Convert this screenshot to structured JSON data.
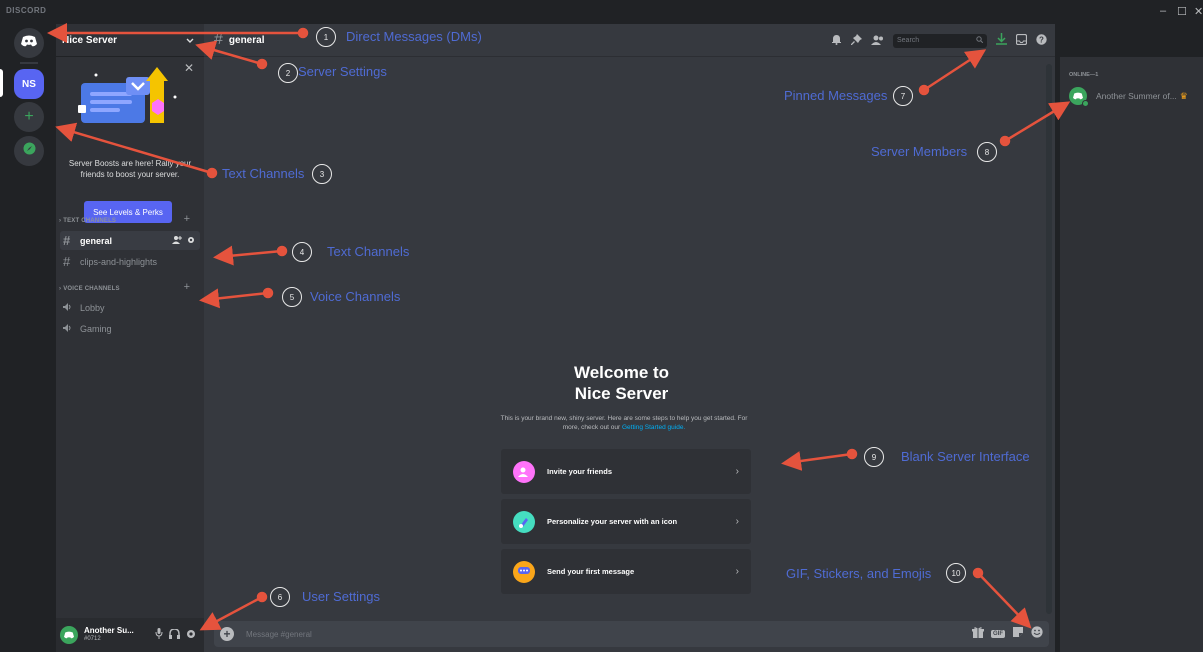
{
  "titlebar": {
    "brand": "DISCORD",
    "minimize": "–",
    "maximize": "☐",
    "close": "✕"
  },
  "rail": {
    "server_initials": "NS",
    "add_symbol": "+"
  },
  "sidebar": {
    "server_name": "Nice Server",
    "boost": {
      "text": "Server Boosts are here! Rally your friends to boost your server.",
      "button": "See Levels & Perks"
    },
    "categories": [
      {
        "label": "TEXT CHANNELS",
        "channels": [
          "general",
          "clips-and-highlights"
        ]
      },
      {
        "label": "VOICE CHANNELS",
        "channels": [
          "Lobby",
          "Gaming"
        ]
      }
    ]
  },
  "user": {
    "name": "Another Su...",
    "tag": "#0712"
  },
  "header": {
    "channel": "general",
    "search_placeholder": "Search"
  },
  "welcome": {
    "title_line1": "Welcome to",
    "title_line2": "Nice Server",
    "desc": "This is your brand new, shiny server. Here are some steps to help you get started. For more, check out our ",
    "link": "Getting Started guide.",
    "actions": [
      "Invite your friends",
      "Personalize your server with an icon",
      "Send your first message"
    ]
  },
  "composer": {
    "placeholder": "Message #general",
    "gif": "GIF"
  },
  "members": {
    "category": "ONLINE—1",
    "list": [
      "Another Summer of..."
    ]
  },
  "annotations": [
    {
      "num": "1",
      "label": "Direct Messages (DMs)"
    },
    {
      "num": "2",
      "label": "Server Settings"
    },
    {
      "num": "3",
      "label": "Text Channels"
    },
    {
      "num": "4",
      "label": "Text Channels"
    },
    {
      "num": "5",
      "label": "Voice Channels"
    },
    {
      "num": "6",
      "label": "User Settings"
    },
    {
      "num": "7",
      "label": "Pinned Messages"
    },
    {
      "num": "8",
      "label": "Server Members"
    },
    {
      "num": "9",
      "label": "Blank Server Interface"
    },
    {
      "num": "10",
      "label": "GIF, Stickers, and Emojis"
    }
  ],
  "colors": {
    "blurple": "#5865f2",
    "green": "#3ba55d",
    "annotation_red": "#e5533d",
    "annotation_blue": "#4f6bd3"
  }
}
